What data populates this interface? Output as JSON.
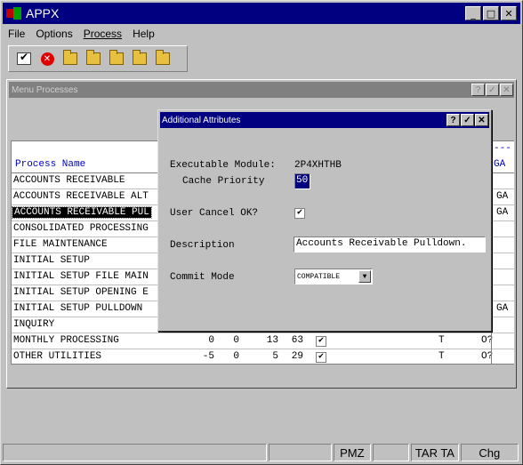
{
  "app": {
    "title": "APPX"
  },
  "menu": [
    "File",
    "Options",
    "Process",
    "Help"
  ],
  "toolbar": {
    "icons": [
      "ok-check-icon",
      "cancel-stop-icon",
      "folder-new-icon",
      "folder-open-icon",
      "folder-search-icon",
      "folder-delete-icon",
      "folder-check-icon"
    ]
  },
  "child": {
    "title": "Menu Processes",
    "buttons": [
      "?",
      "✓",
      "✕"
    ],
    "header": {
      "process_name": "Process Name",
      "right_col": "GA",
      "dashes": "---"
    },
    "rows": [
      {
        "name": "ACCOUNTS RECEIVABLE",
        "right": ""
      },
      {
        "name": "ACCOUNTS RECEIVABLE ALT",
        "right": "GA"
      },
      {
        "name": "ACCOUNTS RECEIVABLE PUL",
        "right": "GA",
        "selected": true
      },
      {
        "name": "CONSOLIDATED PROCESSING",
        "right": ""
      },
      {
        "name": "FILE MAINTENANCE",
        "right": ""
      },
      {
        "name": "INITIAL SETUP",
        "right": ""
      },
      {
        "name": "INITIAL SETUP FILE MAIN",
        "right": ""
      },
      {
        "name": "INITIAL SETUP OPENING E",
        "right": ""
      },
      {
        "name": "INITIAL SETUP PULLDOWN",
        "right": "GA"
      },
      {
        "name": "INQUIRY",
        "right": ""
      },
      {
        "name": "MONTHLY PROCESSING",
        "v1": "0",
        "v2": "0",
        "v3": "13",
        "v4": "63",
        "checked": true,
        "t": "T",
        "o": "O?"
      },
      {
        "name": "OTHER UTILITIES",
        "v1": "-5",
        "v2": "0",
        "v3": "5",
        "v4": "29",
        "checked": true,
        "t": "T",
        "o": "O?"
      }
    ]
  },
  "dialog": {
    "title": "Additional Attributes",
    "buttons": [
      "?",
      "✓",
      "✕"
    ],
    "executable_module_label": "Executable Module:",
    "executable_module_value": "2P4XHTHB",
    "cache_priority_label": "Cache Priority",
    "cache_priority_value": "50",
    "user_cancel_label": "User Cancel OK?",
    "user_cancel_checked": true,
    "description_label": "Description",
    "description_value": "Accounts Receivable Pulldown.",
    "commit_mode_label": "Commit Mode",
    "commit_mode_value": "COMPATIBLE"
  },
  "status": {
    "panels": [
      "",
      "",
      "PMZ",
      "",
      "TAR TA",
      "Chg"
    ]
  }
}
